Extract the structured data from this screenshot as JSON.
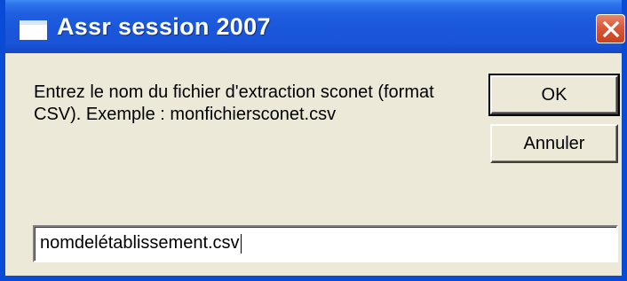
{
  "window": {
    "title": "Assr session 2007",
    "icon": "window-icon",
    "close_icon": "close-icon"
  },
  "dialog": {
    "message": "Entrez le nom du fichier d'extraction sconet (format CSV). Exemple : monfichiersconet.csv",
    "ok_label": "OK",
    "cancel_label": "Annuler",
    "input_value": "nomdelétablissement.csv"
  },
  "colors": {
    "titlebar": "#1a55d8",
    "window_bg": "#ece9d8",
    "close_button": "#d9593a"
  }
}
